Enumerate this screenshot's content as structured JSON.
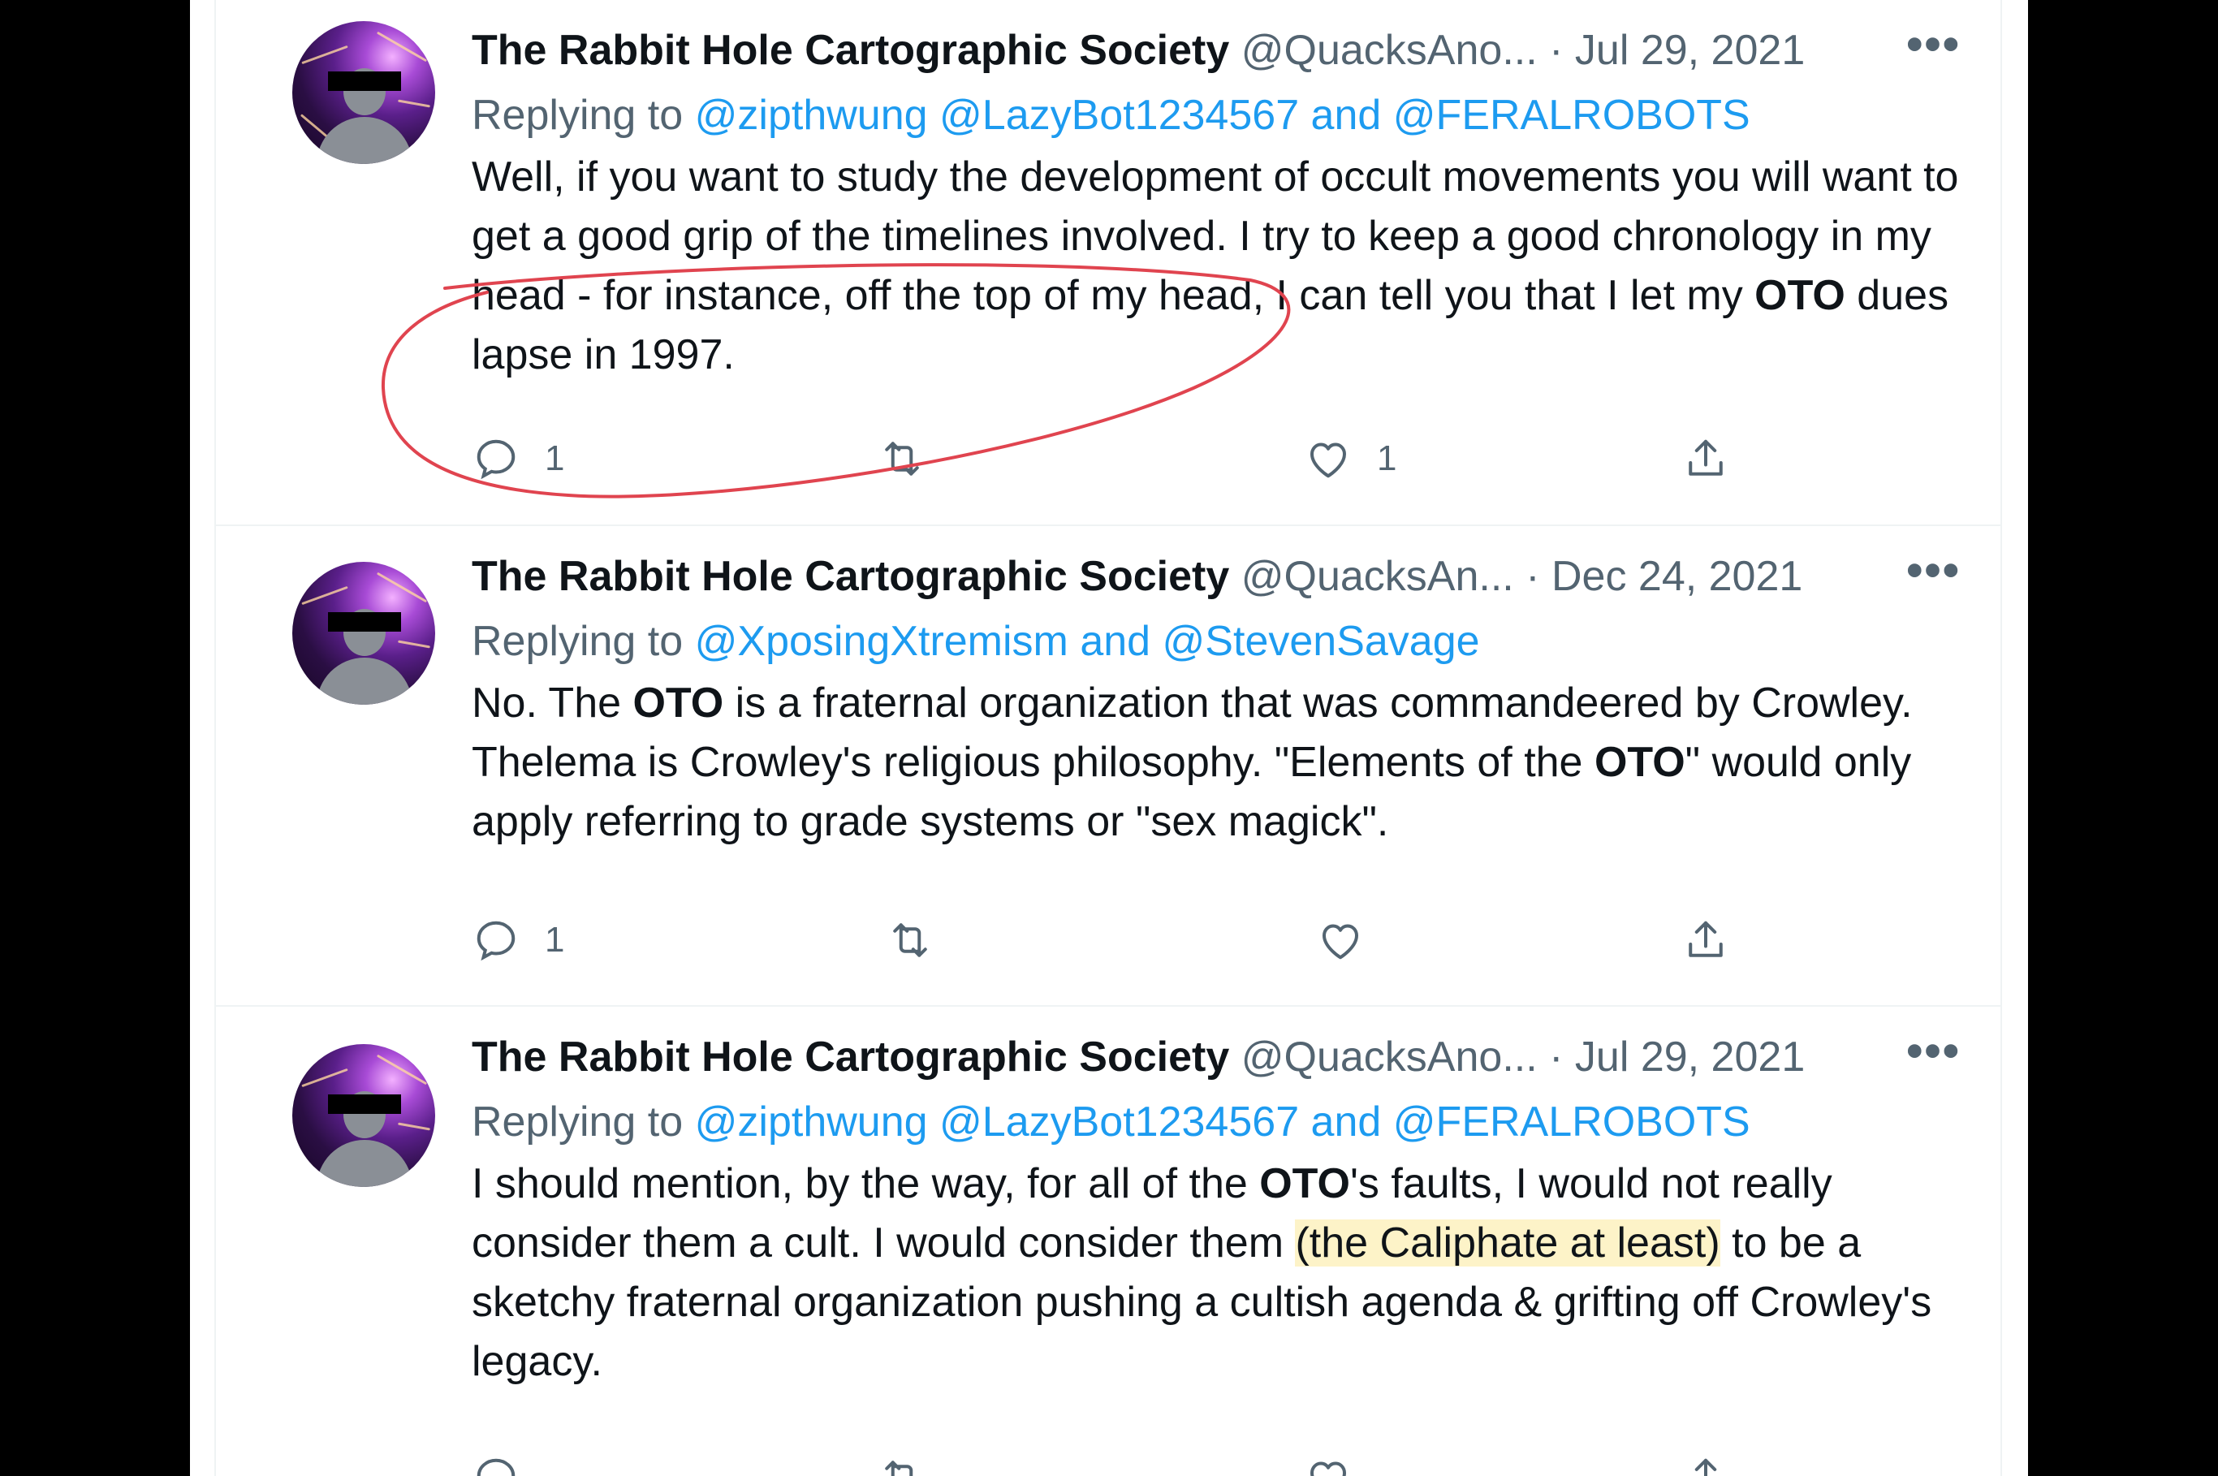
{
  "tweets": [
    {
      "author_name": "The Rabbit Hole Cartographic Society",
      "handle": "@QuacksAno...",
      "separator": "·",
      "date": "Jul 29, 2021",
      "more": "•••",
      "replying_label": "Replying to",
      "replying_to": "@zipthwung @LazyBot1234567 and @FERALROBOTS",
      "body": {
        "part1": "Well, if you want to study the development of occult movements you will want to get a good grip of the timelines involved. I try to keep a good chronology in my head - for instance, off the top of my head, I can tell you that I let my ",
        "bold1": "OTO",
        "part2": " dues lapse in 1997."
      },
      "reply_count": "1",
      "retweet_count": "",
      "like_count": "1"
    },
    {
      "author_name": "The Rabbit Hole Cartographic Society",
      "handle": "@QuacksAn...",
      "separator": "·",
      "date": "Dec 24, 2021",
      "more": "•••",
      "replying_label": "Replying to",
      "replying_to": "@XposingXtremism and @StevenSavage",
      "body": {
        "part1": "No. The ",
        "bold1": "OTO",
        "part2": " is a fraternal organization that was commandeered by Crowley. Thelema is Crowley's religious philosophy. \"Elements of the ",
        "bold2": "OTO",
        "part3": "\" would only apply referring to grade systems or \"sex magick\"."
      },
      "reply_count": "1",
      "retweet_count": "",
      "like_count": ""
    },
    {
      "author_name": "The Rabbit Hole Cartographic Society",
      "handle": "@QuacksAno...",
      "separator": "·",
      "date": "Jul 29, 2021",
      "more": "•••",
      "replying_label": "Replying to",
      "replying_to": "@zipthwung @LazyBot1234567 and @FERALROBOTS",
      "body": {
        "part1": "I should mention, by the way, for all of the ",
        "bold1": "OTO",
        "part2": "'s faults, I would not really consider them a cult. I would consider them ",
        "highlight": "(the Caliphate at least)",
        "part3": " to be a sketchy fraternal organization pushing a cultish agenda & grifting off Crowley's legacy."
      },
      "reply_count": "",
      "retweet_count": "",
      "like_count": ""
    }
  ],
  "icons": {
    "reply": "reply-icon",
    "retweet": "retweet-icon",
    "like": "heart-icon",
    "share": "share-icon",
    "more": "more-icon"
  },
  "colors": {
    "link": "#1d9bf0",
    "secondary_text": "#536471",
    "annotation": "#e0444f",
    "highlight": "#fdf3c8"
  }
}
